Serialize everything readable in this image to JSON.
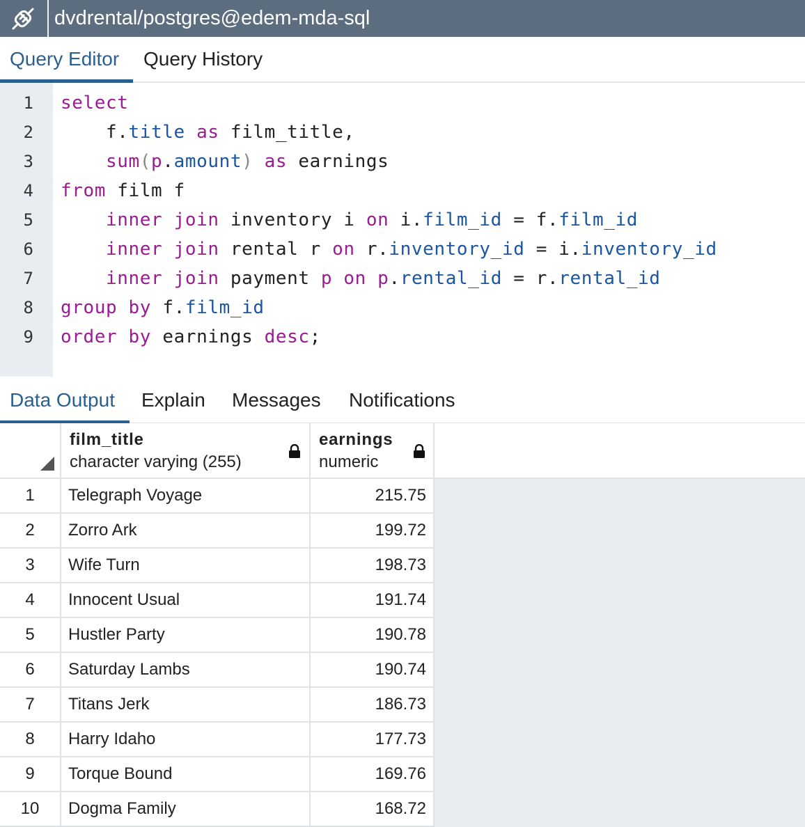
{
  "header": {
    "connection_title": "dvdrental/postgres@edem-mda-sql",
    "icon": "connection-plug-icon"
  },
  "editor_tabs": [
    {
      "label": "Query Editor",
      "active": true
    },
    {
      "label": "Query History",
      "active": false
    }
  ],
  "editor": {
    "line_numbers": [
      "1",
      "2",
      "3",
      "4",
      "5",
      "6",
      "7",
      "8",
      "9"
    ],
    "sql_lines": [
      "select",
      "    f.title as film_title,",
      "    sum(p.amount) as earnings",
      "from film f",
      "    inner join inventory i on i.film_id = f.film_id",
      "    inner join rental r on r.inventory_id = i.inventory_id",
      "    inner join payment p on p.rental_id = r.rental_id",
      "group by f.film_id",
      "order by earnings desc;"
    ]
  },
  "output_tabs": [
    {
      "label": "Data Output",
      "active": true
    },
    {
      "label": "Explain",
      "active": false
    },
    {
      "label": "Messages",
      "active": false
    },
    {
      "label": "Notifications",
      "active": false
    }
  ],
  "results": {
    "columns": [
      {
        "name": "film_title",
        "type": "character varying (255)",
        "icon": "lock-icon"
      },
      {
        "name": "earnings",
        "type": "numeric",
        "icon": "lock-icon"
      }
    ],
    "rows": [
      {
        "num": "1",
        "film_title": "Telegraph Voyage",
        "earnings": "215.75"
      },
      {
        "num": "2",
        "film_title": "Zorro Ark",
        "earnings": "199.72"
      },
      {
        "num": "3",
        "film_title": "Wife Turn",
        "earnings": "198.73"
      },
      {
        "num": "4",
        "film_title": "Innocent Usual",
        "earnings": "191.74"
      },
      {
        "num": "5",
        "film_title": "Hustler Party",
        "earnings": "190.78"
      },
      {
        "num": "6",
        "film_title": "Saturday Lambs",
        "earnings": "190.74"
      },
      {
        "num": "7",
        "film_title": "Titans Jerk",
        "earnings": "186.73"
      },
      {
        "num": "8",
        "film_title": "Harry Idaho",
        "earnings": "177.73"
      },
      {
        "num": "9",
        "film_title": "Torque Bound",
        "earnings": "169.76"
      },
      {
        "num": "10",
        "film_title": "Dogma Family",
        "earnings": "168.72"
      }
    ]
  },
  "colors": {
    "titlebar_bg": "#5b6d7e",
    "accent": "#2b5f8f",
    "keyword": "#9b1b93",
    "property": "#1a56a3"
  }
}
